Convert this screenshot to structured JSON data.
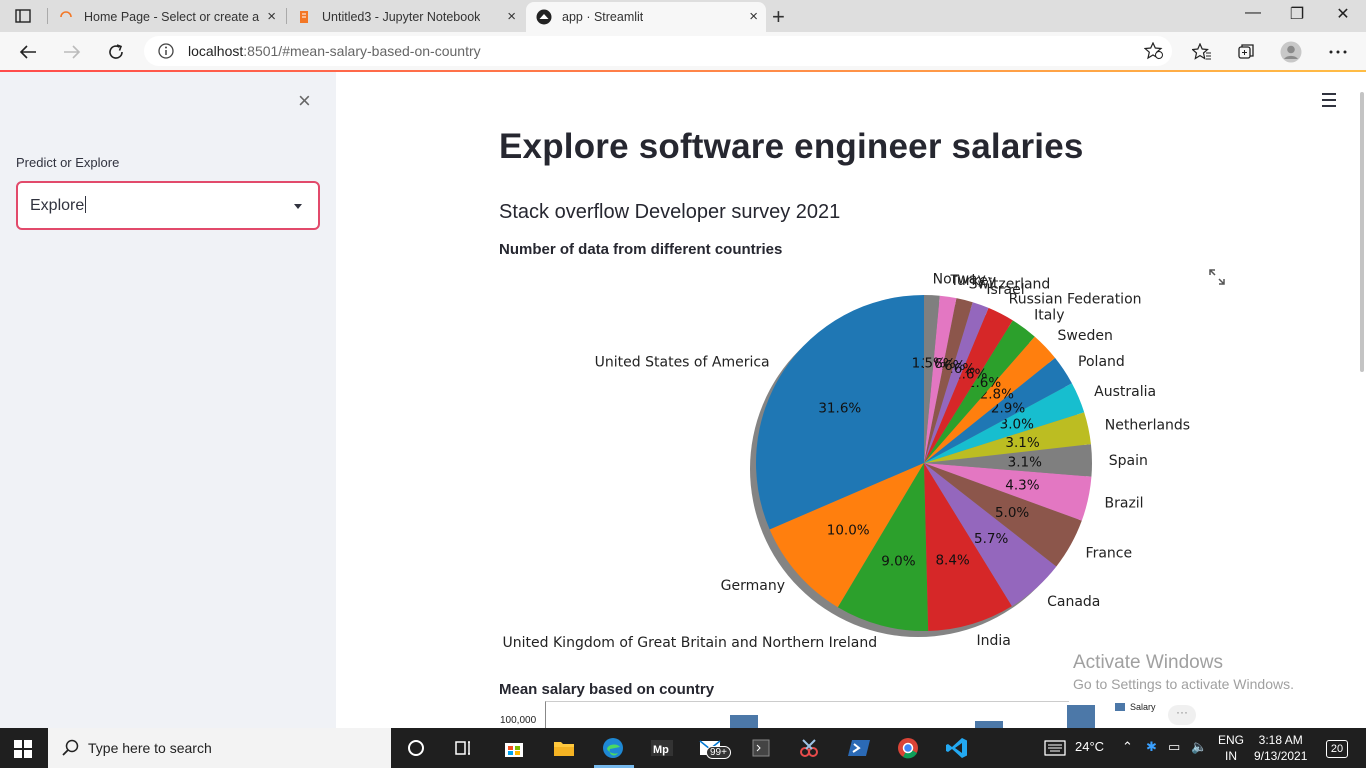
{
  "browser": {
    "tabs": [
      {
        "title": "Home Page - Select or create a n",
        "active": false,
        "favicon": "jupyter-loading-icon"
      },
      {
        "title": "Untitled3 - Jupyter Notebook",
        "active": false,
        "favicon": "jupyter-notebook-icon"
      },
      {
        "title": "app · Streamlit",
        "active": true,
        "favicon": "streamlit-icon"
      }
    ],
    "url_host": "localhost",
    "url_rest": ":8501/#mean-salary-based-on-country",
    "close_glyph": "×",
    "new_tab_glyph": "+",
    "minimize_glyph": "—",
    "maximize_glyph": "❐",
    "close_window_glyph": "✕"
  },
  "sidebar": {
    "close_glyph": "×",
    "select_label": "Predict or Explore",
    "select_value": "Explore"
  },
  "main": {
    "title": "Explore software engineer salaries",
    "subtitle": "Stack overflow Developer survey 2021",
    "pie_heading": "Number of data from different countries",
    "bar_heading": "Mean salary based on country"
  },
  "chart_data": [
    {
      "type": "pie",
      "title": "Number of data from different countries",
      "shadow": true,
      "start_angle_deg": 90,
      "counterclockwise": true,
      "slices": [
        {
          "label": "United States of America",
          "pct": 31.6,
          "color": "#1f77b4",
          "pct_label": "31.6%"
        },
        {
          "label": "Germany",
          "pct": 10.0,
          "color": "#ff7f0e",
          "pct_label": "10.0%"
        },
        {
          "label": "United Kingdom of Great Britain and Northern Ireland",
          "pct": 9.0,
          "color": "#2ca02c",
          "pct_label": "9.0%"
        },
        {
          "label": "India",
          "pct": 8.4,
          "color": "#d62728",
          "pct_label": "8.4%"
        },
        {
          "label": "Canada",
          "pct": 5.7,
          "color": "#9467bd",
          "pct_label": "5.7%"
        },
        {
          "label": "France",
          "pct": 5.0,
          "color": "#8c564b",
          "pct_label": "5.0%"
        },
        {
          "label": "Brazil",
          "pct": 4.3,
          "color": "#e377c2",
          "pct_label": "4.3%"
        },
        {
          "label": "Spain",
          "pct": 3.1,
          "color": "#7f7f7f",
          "pct_label": "3.1%"
        },
        {
          "label": "Netherlands",
          "pct": 3.1,
          "color": "#bcbd22",
          "pct_label": "3.1%"
        },
        {
          "label": "Australia",
          "pct": 3.0,
          "color": "#17becf",
          "pct_label": "3.0%"
        },
        {
          "label": "Poland",
          "pct": 2.9,
          "color": "#1f77b4",
          "pct_label": "2.9%"
        },
        {
          "label": "Sweden",
          "pct": 2.8,
          "color": "#ff7f0e",
          "pct_label": "2.8%"
        },
        {
          "label": "Italy",
          "pct": 2.6,
          "color": "#2ca02c",
          "pct_label": "2.6%"
        },
        {
          "label": "Russian Federation",
          "pct": 2.6,
          "color": "#d62728",
          "pct_label": "2.6%"
        },
        {
          "label": "Israel",
          "pct": 1.6,
          "color": "#9467bd",
          "pct_label": "1.6%"
        },
        {
          "label": "Switzerland",
          "pct": 1.6,
          "color": "#8c564b",
          "pct_label": "1.6%"
        },
        {
          "label": "Turkey",
          "pct": 1.6,
          "color": "#e377c2",
          "pct_label": "1.6%"
        },
        {
          "label": "Norway",
          "pct": 1.5,
          "color": "#7f7f7f",
          "pct_label": "1.5%"
        }
      ]
    },
    {
      "type": "bar",
      "title": "Mean salary based on country",
      "ytick_visible": "100,000",
      "legend": [
        "Salary"
      ],
      "visible_bar_tops": [
        "partial"
      ]
    }
  ],
  "watermark": {
    "line1": "Activate Windows",
    "line2": "Go to Settings to activate Windows."
  },
  "taskbar": {
    "search_placeholder": "Type here to search",
    "weather": "24°C",
    "lang1": "ENG",
    "lang2": "IN",
    "time": "3:18 AM",
    "date": "9/13/2021",
    "notifications": "20",
    "mail_badge": "99+"
  }
}
